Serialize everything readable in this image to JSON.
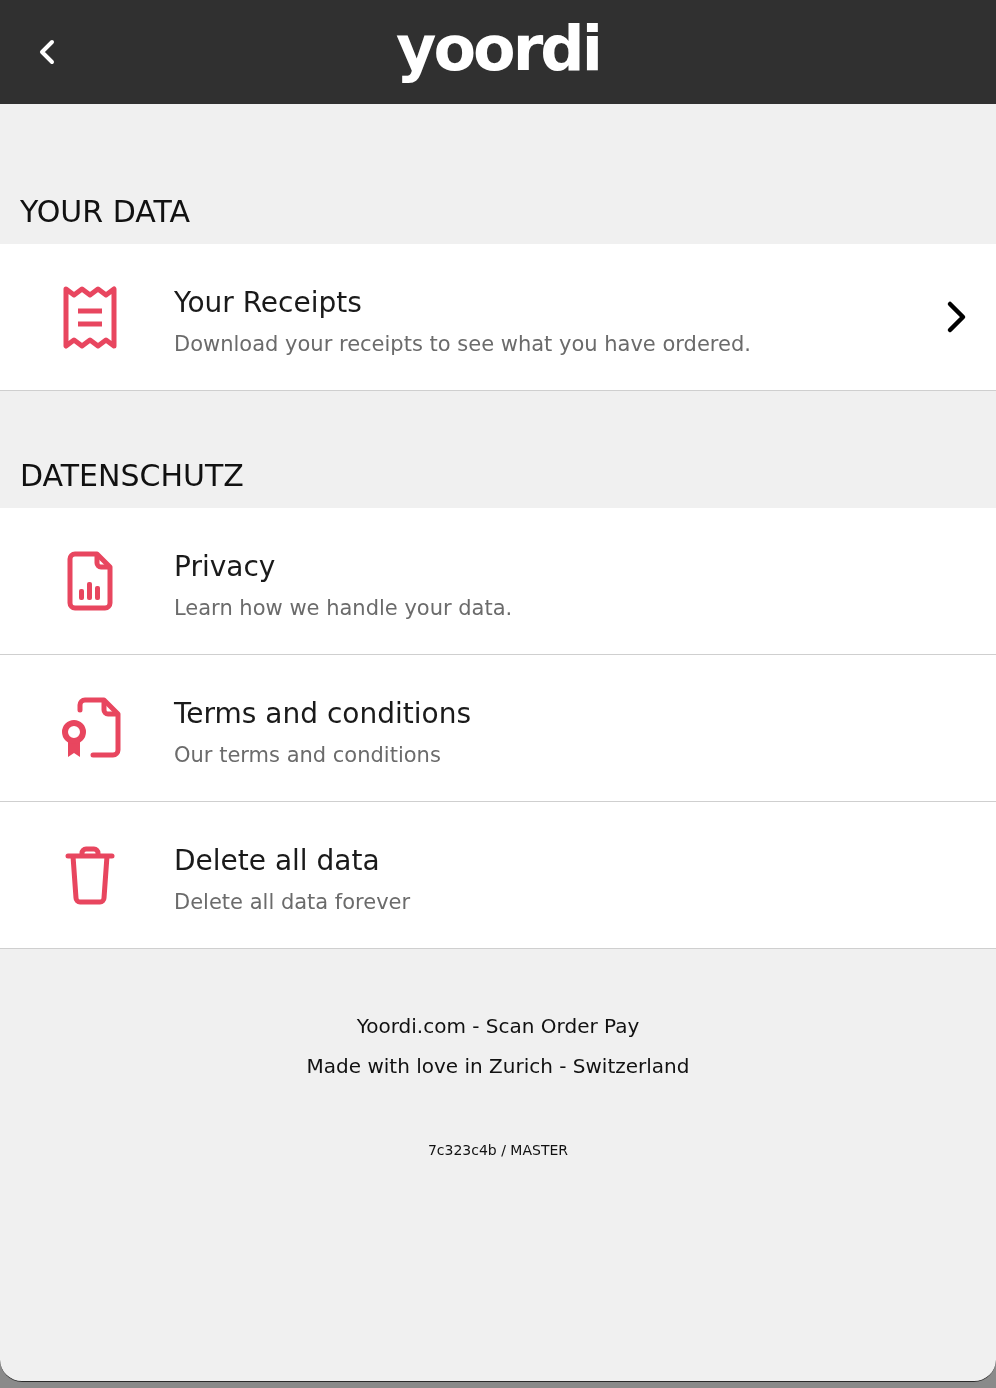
{
  "header": {
    "logo": "yoordi"
  },
  "sections": [
    {
      "title": "YOUR DATA",
      "items": [
        {
          "kind": "receipts",
          "title": "Your Receipts",
          "subtitle": "Download your receipts to see what you have ordered.",
          "chevron": true
        }
      ]
    },
    {
      "title": "DATENSCHUTZ",
      "items": [
        {
          "kind": "privacy",
          "title": "Privacy",
          "subtitle": "Learn how we handle your data.",
          "chevron": false
        },
        {
          "kind": "terms",
          "title": "Terms and conditions",
          "subtitle": "Our terms and conditions",
          "chevron": false
        },
        {
          "kind": "delete",
          "title": "Delete all data",
          "subtitle": "Delete all data forever",
          "chevron": false
        }
      ]
    }
  ],
  "footer": {
    "lines": [
      "Yoordi.com - Scan Order Pay",
      "Made with love in Zurich - Switzerland"
    ],
    "version": "7c323c4b / MASTER"
  }
}
